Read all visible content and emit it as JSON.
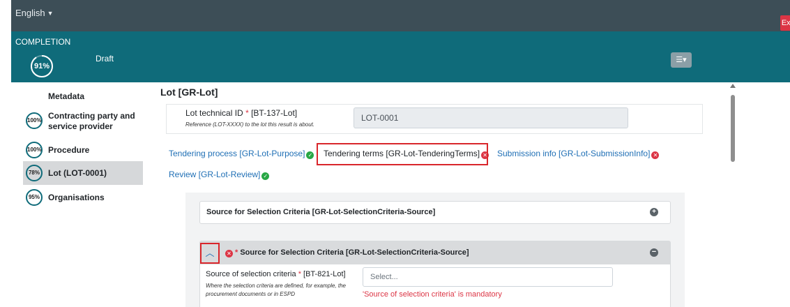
{
  "topbar": {
    "language": "English",
    "exit_label": "Exit"
  },
  "completion": {
    "label": "COMPLETION",
    "percent": "91%",
    "percent_value": 0.91,
    "status": "Draft"
  },
  "sidebar": {
    "metadata_label": "Metadata",
    "items": [
      {
        "percent": "100%",
        "label_line1": "Contracting party and",
        "label_line2": "service provider",
        "active": false
      },
      {
        "percent": "100%",
        "label_line1": "Procedure",
        "label_line2": "",
        "active": false
      },
      {
        "percent": "78%",
        "label_line1": "Lot (LOT-0001)",
        "label_line2": "",
        "active": true
      },
      {
        "percent": "95%",
        "label_line1": "Organisations",
        "label_line2": "",
        "active": false
      }
    ]
  },
  "lot": {
    "title": "Lot [GR-Lot]",
    "id_label": "Lot technical ID",
    "id_required": "*",
    "id_code": "[BT-137-Lot]",
    "id_hint": "Reference (LOT-XXXX) to the lot this result is about.",
    "id_value": "LOT-0001"
  },
  "tabs": [
    {
      "label": "Tendering process  [GR-Lot-Purpose]",
      "status": "ok"
    },
    {
      "label": "Tendering terms  [GR-Lot-TenderingTerms]",
      "status": "error"
    },
    {
      "label": "Submission info  [GR-Lot-SubmissionInfo]",
      "status": "error"
    },
    {
      "label": "Review  [GR-Lot-Review]",
      "status": "ok"
    }
  ],
  "accordion1": {
    "title": "Source for Selection Criteria  [GR-Lot-SelectionCriteria-Source]"
  },
  "accordion2": {
    "title": "Source for Selection Criteria  [GR-Lot-SelectionCriteria-Source]",
    "required_mark": "*",
    "field_label": "Source of selection criteria",
    "field_required": "*",
    "field_code": "[BT-821-Lot]",
    "field_hint": "Where the selection criteria are defined, for example, the procurement documents or in ESPD",
    "select_placeholder": "Select...",
    "error": "'Source of selection criteria' is mandatory"
  },
  "colors": {
    "topbar": "#3d4e57",
    "completion_bar": "#0f6b7a",
    "link": "#1f6fb5",
    "error": "#dc3545",
    "ok": "#28a745",
    "highlight": "#d9262b"
  }
}
